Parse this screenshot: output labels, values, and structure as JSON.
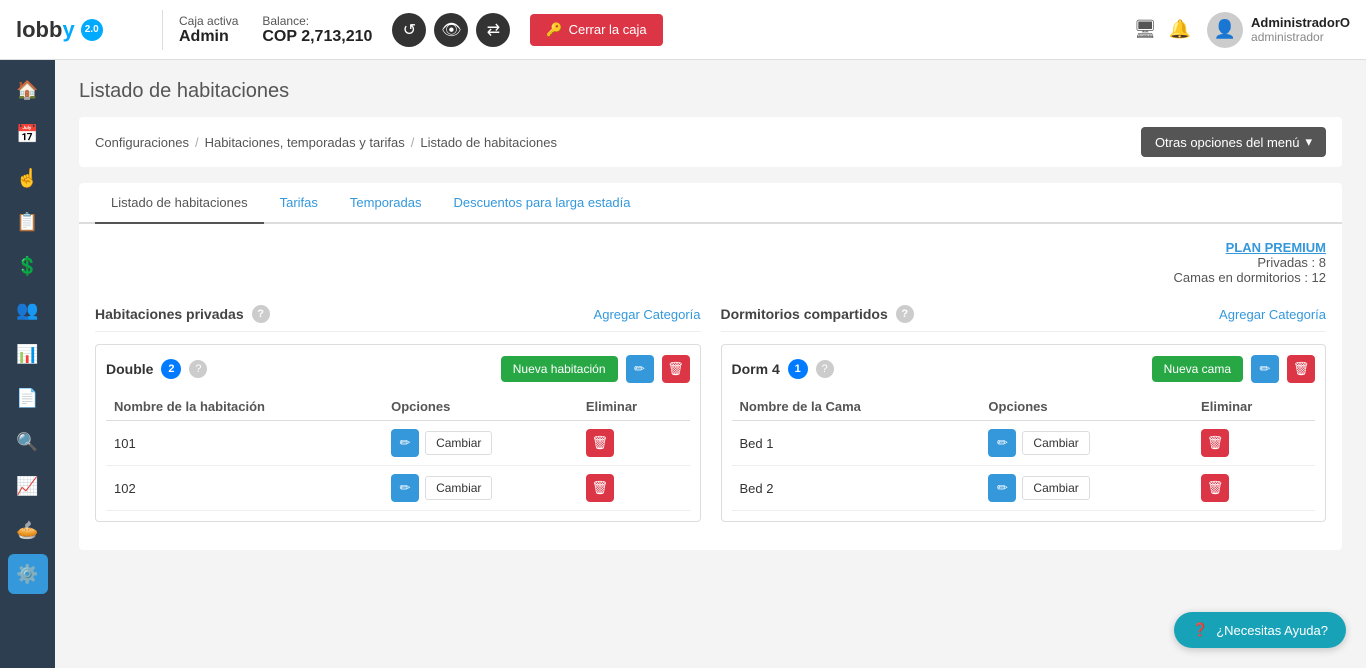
{
  "logo": {
    "text": "lobby",
    "version": "2.0"
  },
  "header": {
    "caja_label": "Caja activa",
    "caja_name": "Admin",
    "balance_label": "Balance:",
    "balance_amount": "COP 2,713,210",
    "close_caja_label": "Cerrar la caja",
    "user_name": "AdministradorO",
    "user_role": "administrador"
  },
  "sidebar": {
    "items": [
      {
        "icon": "🏠",
        "name": "home"
      },
      {
        "icon": "📅",
        "name": "calendar"
      },
      {
        "icon": "👆",
        "name": "pointer"
      },
      {
        "icon": "📋",
        "name": "list"
      },
      {
        "icon": "💲",
        "name": "money"
      },
      {
        "icon": "👥",
        "name": "users"
      },
      {
        "icon": "📊",
        "name": "reports"
      },
      {
        "icon": "📄",
        "name": "document"
      },
      {
        "icon": "🔍",
        "name": "search"
      },
      {
        "icon": "📈",
        "name": "analytics"
      },
      {
        "icon": "🥧",
        "name": "pie"
      },
      {
        "icon": "⚙️",
        "name": "settings",
        "active": true
      }
    ]
  },
  "page": {
    "title": "Listado de habitaciones",
    "breadcrumb": {
      "configuraciones": "Configuraciones",
      "habitaciones": "Habitaciones, temporadas y tarifas",
      "listado": "Listado de habitaciones"
    },
    "other_options_label": "Otras opciones del menú",
    "tabs": [
      {
        "label": "Listado de habitaciones",
        "active": true
      },
      {
        "label": "Tarifas"
      },
      {
        "label": "Temporadas"
      },
      {
        "label": "Descuentos para larga estadía"
      }
    ],
    "plan_link": "PLAN PREMIUM",
    "privadas_label": "Privadas : 8",
    "camas_label": "Camas en dormitorios : 12",
    "habitaciones_privadas": {
      "title": "Habitaciones privadas",
      "add_category_label": "Agregar Categoría",
      "categories": [
        {
          "name": "Double",
          "count": "2",
          "nueva_label": "Nueva habitación",
          "columns": [
            "Nombre de la habitación",
            "Opciones",
            "Eliminar"
          ],
          "rooms": [
            {
              "name": "101",
              "cambiar": "Cambiar"
            },
            {
              "name": "102",
              "cambiar": "Cambiar"
            }
          ]
        }
      ]
    },
    "dormitorios": {
      "title": "Dormitorios compartidos",
      "add_category_label": "Agregar Categoría",
      "categories": [
        {
          "name": "Dorm 4",
          "count": "1",
          "nueva_label": "Nueva cama",
          "columns": [
            "Nombre de la Cama",
            "Opciones",
            "Eliminar"
          ],
          "rooms": [
            {
              "name": "Bed 1",
              "cambiar": "Cambiar"
            },
            {
              "name": "Bed 2",
              "cambiar": "Cambiar"
            }
          ]
        }
      ]
    }
  },
  "help_button": "¿Necesitas Ayuda?"
}
